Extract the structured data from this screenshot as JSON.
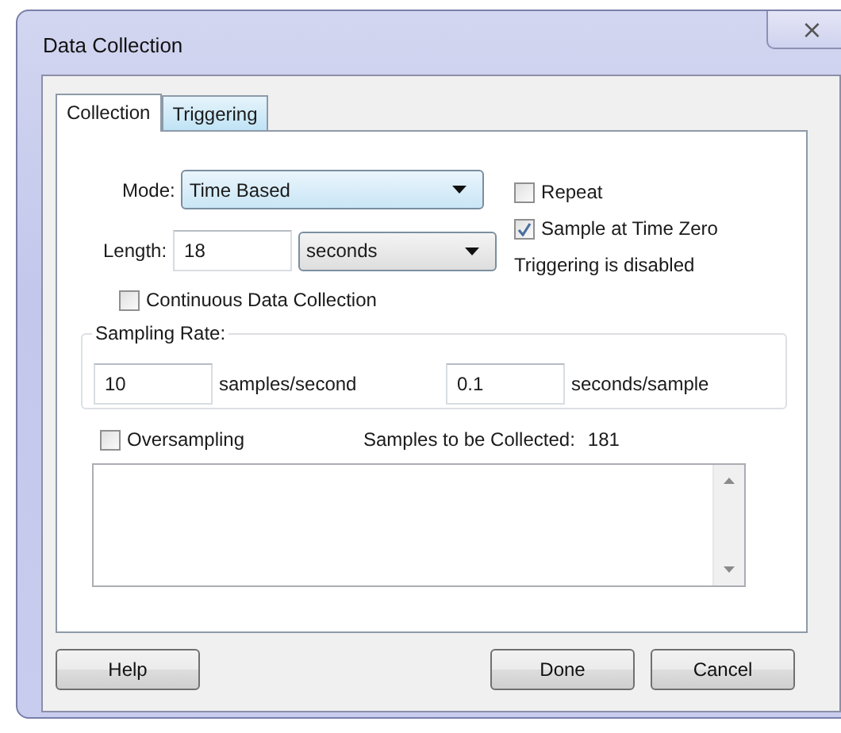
{
  "window": {
    "title": "Data Collection",
    "close_label": "⨯"
  },
  "tabs": [
    {
      "label": "Collection",
      "selected": true
    },
    {
      "label": "Triggering",
      "selected": false
    }
  ],
  "mode": {
    "label": "Mode:",
    "value": "Time Based"
  },
  "length": {
    "label": "Length:",
    "value": "18",
    "unit": "seconds"
  },
  "options": [
    {
      "label": "Repeat",
      "checked": false
    },
    {
      "label": "Sample at Time Zero",
      "checked": true
    }
  ],
  "trigger_status": "Triggering is disabled",
  "continuous": {
    "label": "Continuous Data Collection",
    "checked": false
  },
  "sampling_rate": {
    "title": "Sampling Rate:",
    "rate": "10",
    "rate_unit": "samples/second",
    "period": "0.1",
    "period_unit": "seconds/sample"
  },
  "oversampling": {
    "label": "Oversampling",
    "checked": false
  },
  "samples_collected": {
    "label": "Samples to be Collected:",
    "value": "181"
  },
  "buttons": [
    {
      "label": "Help"
    },
    {
      "label": "Done"
    },
    {
      "label": "Cancel"
    }
  ]
}
